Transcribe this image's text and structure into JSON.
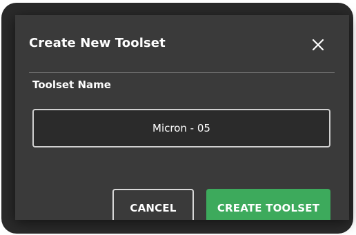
{
  "dialog": {
    "title": "Create New Toolset",
    "close_icon": "close-icon",
    "field_label": "Toolset Name",
    "input_value": "Micron - 05",
    "cancel_label": "CANCEL",
    "create_label": "CREATE TOOLSET"
  },
  "colors": {
    "dialog_background": "#3a3a3a",
    "backdrop": "#2a2a2a",
    "primary_button": "#3daa5c",
    "text": "#ffffff"
  }
}
